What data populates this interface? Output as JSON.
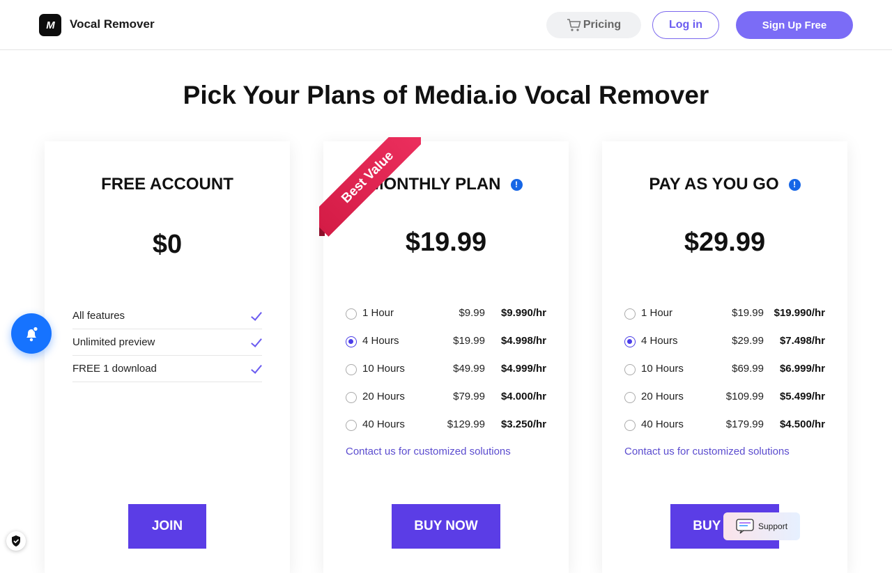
{
  "header": {
    "logo_text": "M",
    "brand": "Vocal Remover",
    "pricing_label": "Pricing",
    "login_label": "Log in",
    "signup_label": "Sign Up Free"
  },
  "title": "Pick Your Plans of Media.io Vocal Remover",
  "free": {
    "title": "FREE ACCOUNT",
    "price": "$0",
    "features": [
      "All features",
      "Unlimited preview",
      "FREE 1 download"
    ],
    "cta": "JOIN"
  },
  "monthly": {
    "ribbon": "Best Value",
    "title": "MONTHLY PLAN",
    "price": "$19.99",
    "options": [
      {
        "label": "1 Hour",
        "price": "$9.99",
        "rate": "$9.990/hr",
        "selected": false
      },
      {
        "label": "4 Hours",
        "price": "$19.99",
        "rate": "$4.998/hr",
        "selected": true
      },
      {
        "label": "10 Hours",
        "price": "$49.99",
        "rate": "$4.999/hr",
        "selected": false
      },
      {
        "label": "20 Hours",
        "price": "$79.99",
        "rate": "$4.000/hr",
        "selected": false
      },
      {
        "label": "40 Hours",
        "price": "$129.99",
        "rate": "$3.250/hr",
        "selected": false
      }
    ],
    "contact": "Contact us for customized solutions",
    "cta": "BUY NOW"
  },
  "payg": {
    "title": "PAY AS YOU GO",
    "price": "$29.99",
    "options": [
      {
        "label": "1 Hour",
        "price": "$19.99",
        "rate": "$19.990/hr",
        "selected": false
      },
      {
        "label": "4 Hours",
        "price": "$29.99",
        "rate": "$7.498/hr",
        "selected": true
      },
      {
        "label": "10 Hours",
        "price": "$69.99",
        "rate": "$6.999/hr",
        "selected": false
      },
      {
        "label": "20 Hours",
        "price": "$109.99",
        "rate": "$5.499/hr",
        "selected": false
      },
      {
        "label": "40 Hours",
        "price": "$179.99",
        "rate": "$4.500/hr",
        "selected": false
      }
    ],
    "contact": "Contact us for customized solutions",
    "cta": "BUY NOW"
  },
  "support_label": "Support",
  "colors": {
    "accent": "#5b3de6",
    "signup": "#7b6cf6",
    "ribbon": "#e12852",
    "info": "#1666e6",
    "bell": "#1673ff"
  },
  "icons": [
    "cart-icon",
    "info-icon",
    "check-icon",
    "bell-icon",
    "shield-icon",
    "chat-icon"
  ]
}
